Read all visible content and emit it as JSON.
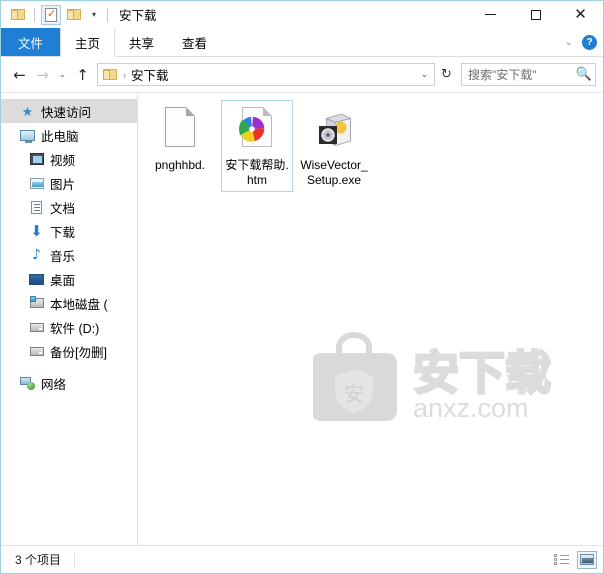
{
  "window": {
    "title": "安下载",
    "quick_access": {
      "folder_icon": "folder-icon",
      "properties_icon": "properties-checkmark-icon",
      "new_folder_icon": "new-folder-icon",
      "customize_caret": "▾"
    },
    "controls": {
      "minimize": "—",
      "maximize": "□",
      "close": "✕",
      "ribbon_collapse": "⌄",
      "help": "?"
    }
  },
  "ribbon": {
    "tabs": [
      {
        "label": "文件",
        "state": "file-menu"
      },
      {
        "label": "主页",
        "state": "selected"
      },
      {
        "label": "共享",
        "state": "normal"
      },
      {
        "label": "查看",
        "state": "normal"
      }
    ]
  },
  "addressbar": {
    "back": "←",
    "forward": "→",
    "recent": "⌄",
    "up": "↑",
    "folder_icon": "folder-icon",
    "crumb_separator": "›",
    "path": "安下载",
    "dropdown": "⌄",
    "refresh": "↻",
    "search_placeholder": "搜索\"安下载\"",
    "search_value": "",
    "search_icon": "🔍"
  },
  "sidebar": {
    "items": [
      {
        "label": "快速访问",
        "icon": "star-pin-icon",
        "level": 0,
        "selected": true
      },
      {
        "label": "此电脑",
        "icon": "this-pc-icon",
        "level": 0,
        "selected": false
      },
      {
        "label": "视频",
        "icon": "videos-icon",
        "level": 1,
        "selected": false
      },
      {
        "label": "图片",
        "icon": "pictures-icon",
        "level": 1,
        "selected": false
      },
      {
        "label": "文档",
        "icon": "documents-icon",
        "level": 1,
        "selected": false
      },
      {
        "label": "下载",
        "icon": "downloads-icon",
        "level": 1,
        "selected": false
      },
      {
        "label": "音乐",
        "icon": "music-icon",
        "level": 1,
        "selected": false
      },
      {
        "label": "桌面",
        "icon": "desktop-icon",
        "level": 1,
        "selected": false
      },
      {
        "label": "本地磁盘 (",
        "icon": "local-disk-icon",
        "level": 1,
        "selected": false
      },
      {
        "label": "软件 (D:)",
        "icon": "drive-icon",
        "level": 1,
        "selected": false
      },
      {
        "label": "备份[勿删]",
        "icon": "drive-icon",
        "level": 1,
        "selected": false
      },
      {
        "label": "网络",
        "icon": "network-icon",
        "level": 0,
        "selected": false
      }
    ]
  },
  "files": [
    {
      "name": "pnghhbd.",
      "icon": "blank-file-icon",
      "selected": false
    },
    {
      "name": "安下载帮助.htm",
      "icon": "html-file-icon",
      "selected": true
    },
    {
      "name": "WiseVector_Setup.exe",
      "icon": "setup-exe-icon",
      "selected": false
    }
  ],
  "watermark": {
    "brand": "安下载",
    "domain": "anxz.com",
    "shield_char": "安",
    "color": "#d8d8d8"
  },
  "statusbar": {
    "item_count": "3 个项目",
    "details_view_icon": "details-view-icon",
    "large_icons_view_icon": "large-icons-view-icon"
  },
  "colors": {
    "accent_blue": "#1e7fd4",
    "window_border": "#9ed3dd",
    "selection_border": "#add6ec",
    "sidebar_selected": "#dcdcdc"
  }
}
